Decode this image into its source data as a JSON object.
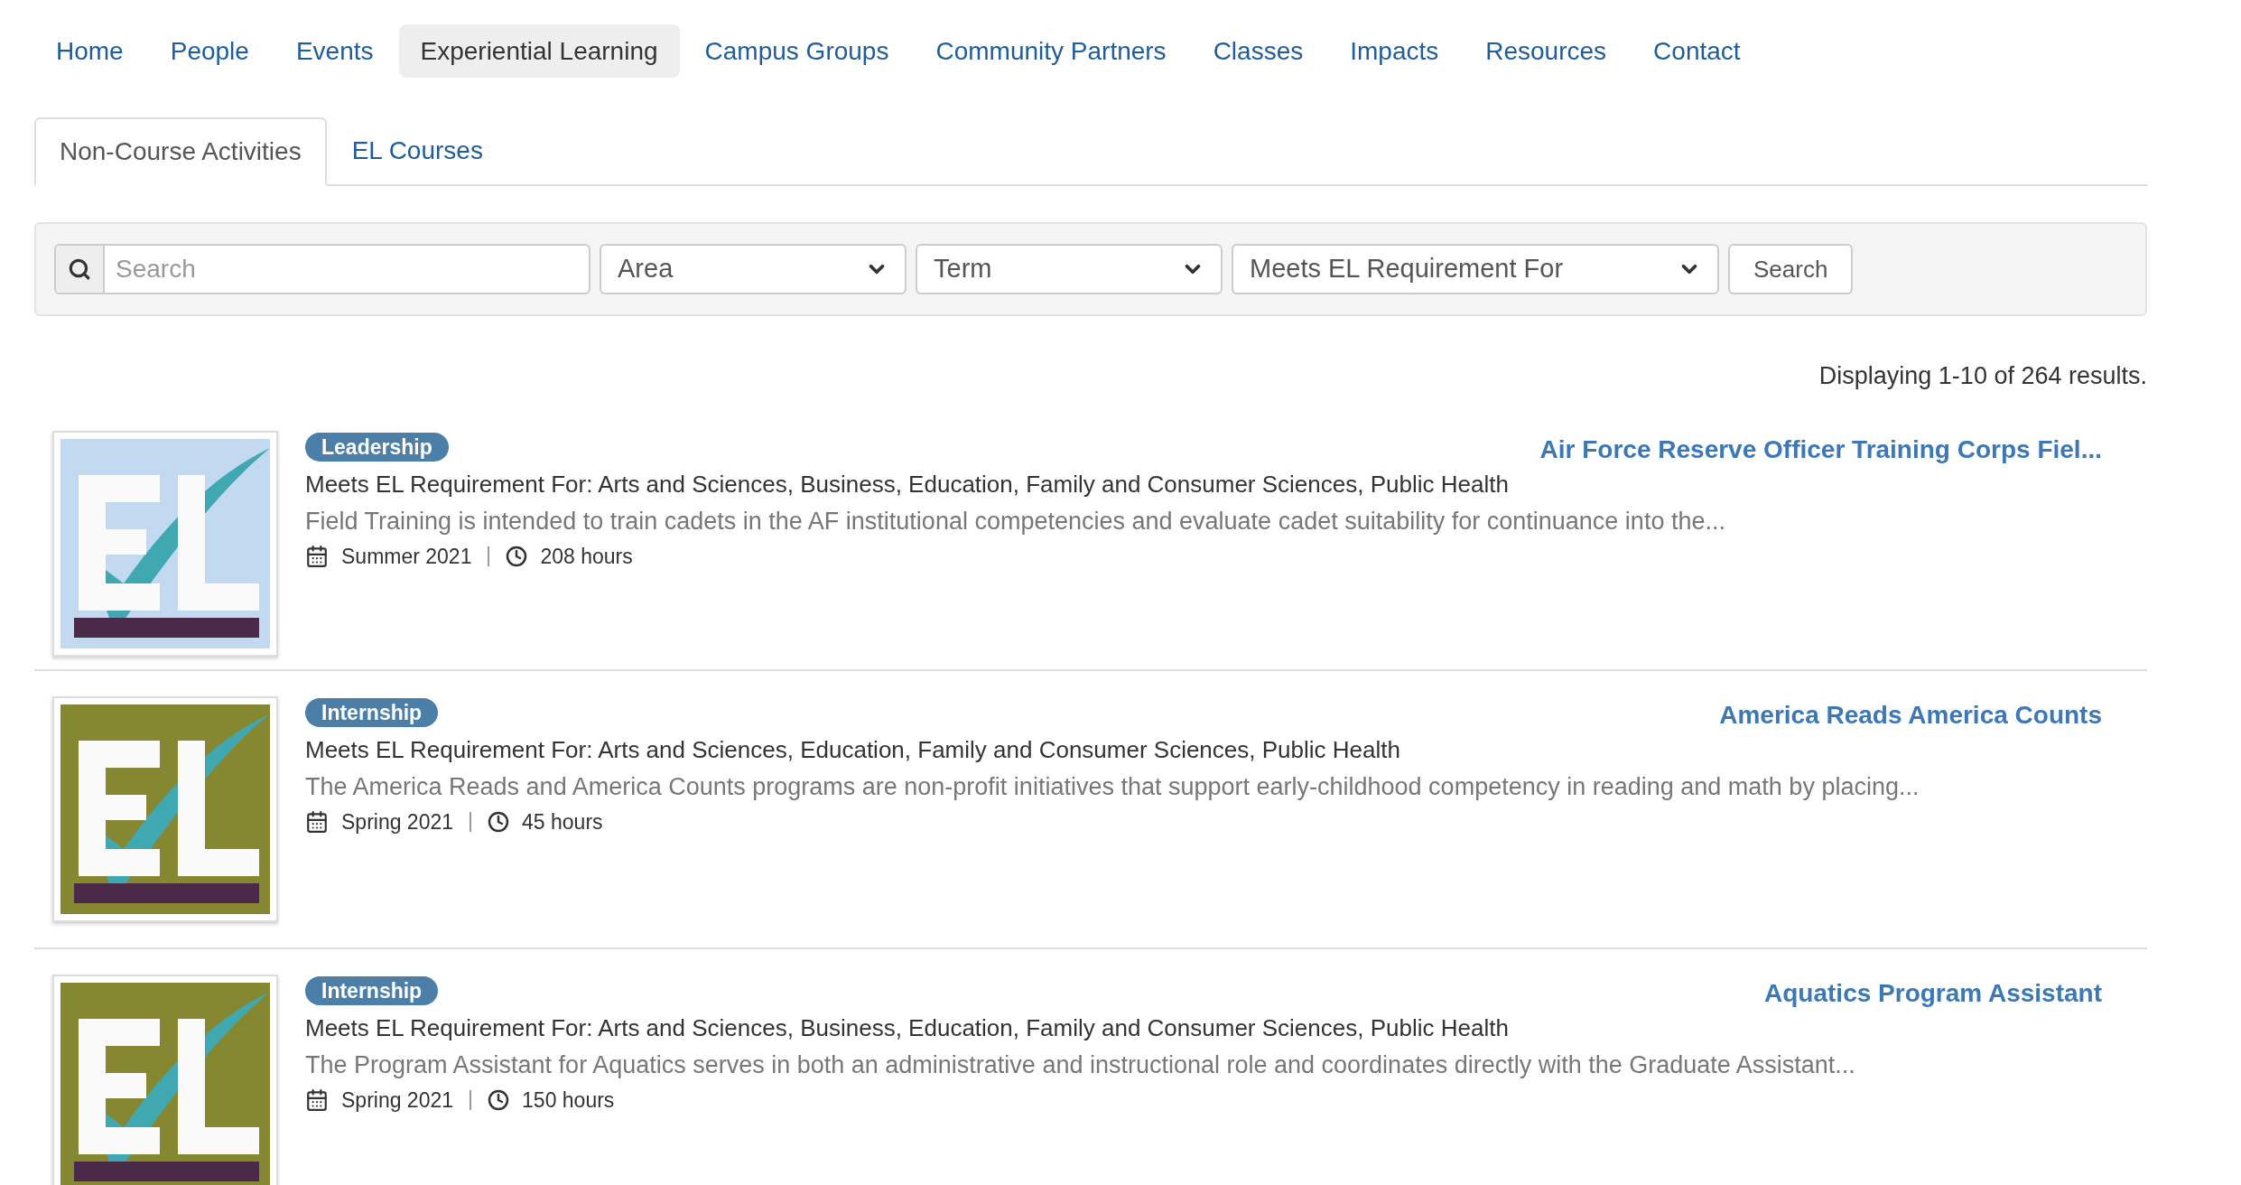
{
  "nav": [
    {
      "label": "Home",
      "selected": false
    },
    {
      "label": "People",
      "selected": false
    },
    {
      "label": "Events",
      "selected": false
    },
    {
      "label": "Experiential Learning",
      "selected": true
    },
    {
      "label": "Campus Groups",
      "selected": false
    },
    {
      "label": "Community Partners",
      "selected": false
    },
    {
      "label": "Classes",
      "selected": false
    },
    {
      "label": "Impacts",
      "selected": false
    },
    {
      "label": "Resources",
      "selected": false
    },
    {
      "label": "Contact",
      "selected": false
    }
  ],
  "tabs": [
    {
      "label": "Non-Course Activities",
      "selected": true
    },
    {
      "label": "EL Courses",
      "selected": false
    }
  ],
  "filters": {
    "search": {
      "placeholder": "Search"
    },
    "selects": [
      {
        "value": "Area"
      },
      {
        "value": "Term"
      },
      {
        "value": "Meets EL Requirement For"
      }
    ],
    "button": "Search"
  },
  "results_summary": "Displaying 1-10 of 264 results.",
  "results": [
    {
      "color": "#c3d9f0",
      "tag": "Leadership",
      "title": "Air Force Reserve Officer Training Corps Fiel...",
      "requirement": "Meets EL Requirement For: Arts and Sciences, Business, Education, Family and Consumer Sciences, Public Health",
      "description": "Field Training is intended to train cadets in the AF institutional competencies and evaluate cadet suitability for continuance into the...",
      "term": "Summer 2021",
      "hours": "208 hours"
    },
    {
      "color": "#858831",
      "tag": "Internship",
      "title": "America Reads America Counts",
      "requirement": "Meets EL Requirement For: Arts and Sciences, Education, Family and Consumer Sciences, Public Health",
      "description": "The America Reads and America Counts programs are non-profit initiatives that support early-childhood competency in reading and math by placing...",
      "term": "Spring 2021",
      "hours": "45 hours"
    },
    {
      "color": "#858831",
      "tag": "Internship",
      "title": "Aquatics Program Assistant",
      "requirement": "Meets EL Requirement For: Arts and Sciences, Business, Education, Family and Consumer Sciences, Public Health",
      "description": "The Program Assistant for Aquatics serves in both an administrative and instructional role and coordinates directly with the Graduate Assistant...",
      "term": "Spring 2021",
      "hours": "150 hours"
    }
  ]
}
